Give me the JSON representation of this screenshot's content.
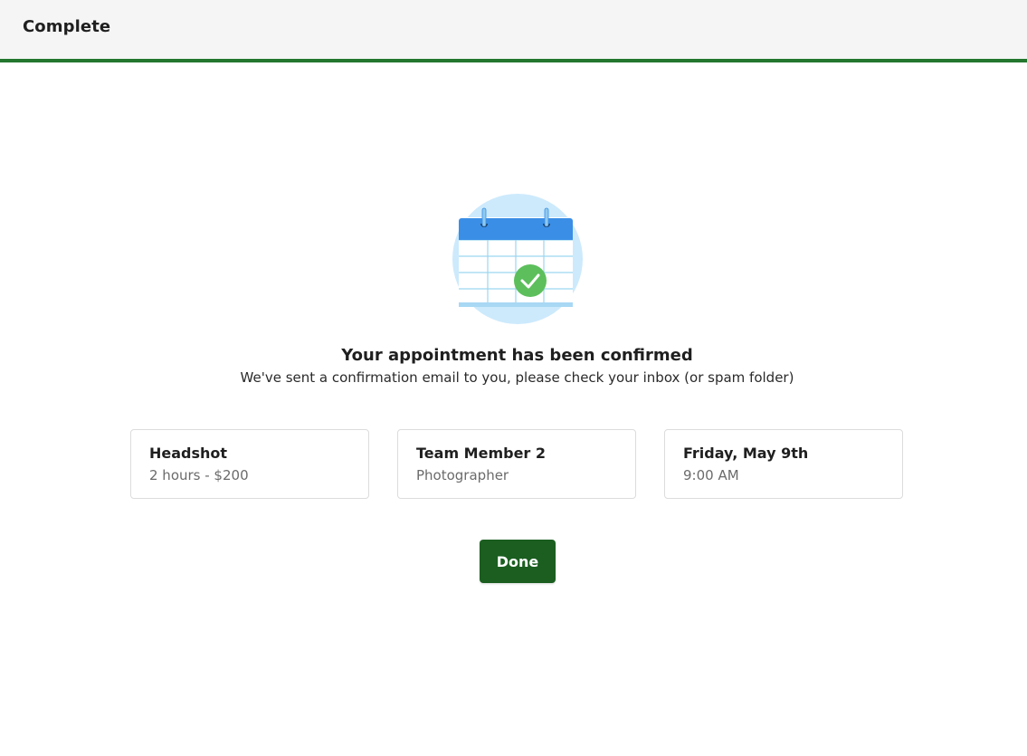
{
  "header": {
    "title": "Complete",
    "accent_color": "#23772e"
  },
  "confirmation": {
    "illustration_icon": "calendar-check-icon",
    "headline": "Your appointment has been confirmed",
    "message": "We've sent a confirmation email to you, please check your inbox (or spam folder)"
  },
  "details": [
    {
      "title": "Headshot",
      "subtitle": "2 hours - $200"
    },
    {
      "title": "Team Member 2",
      "subtitle": "Photographer"
    },
    {
      "title": "Friday, May 9th",
      "subtitle": "9:00 AM"
    }
  ],
  "actions": {
    "done_label": "Done",
    "done_color": "#1b5e20"
  }
}
